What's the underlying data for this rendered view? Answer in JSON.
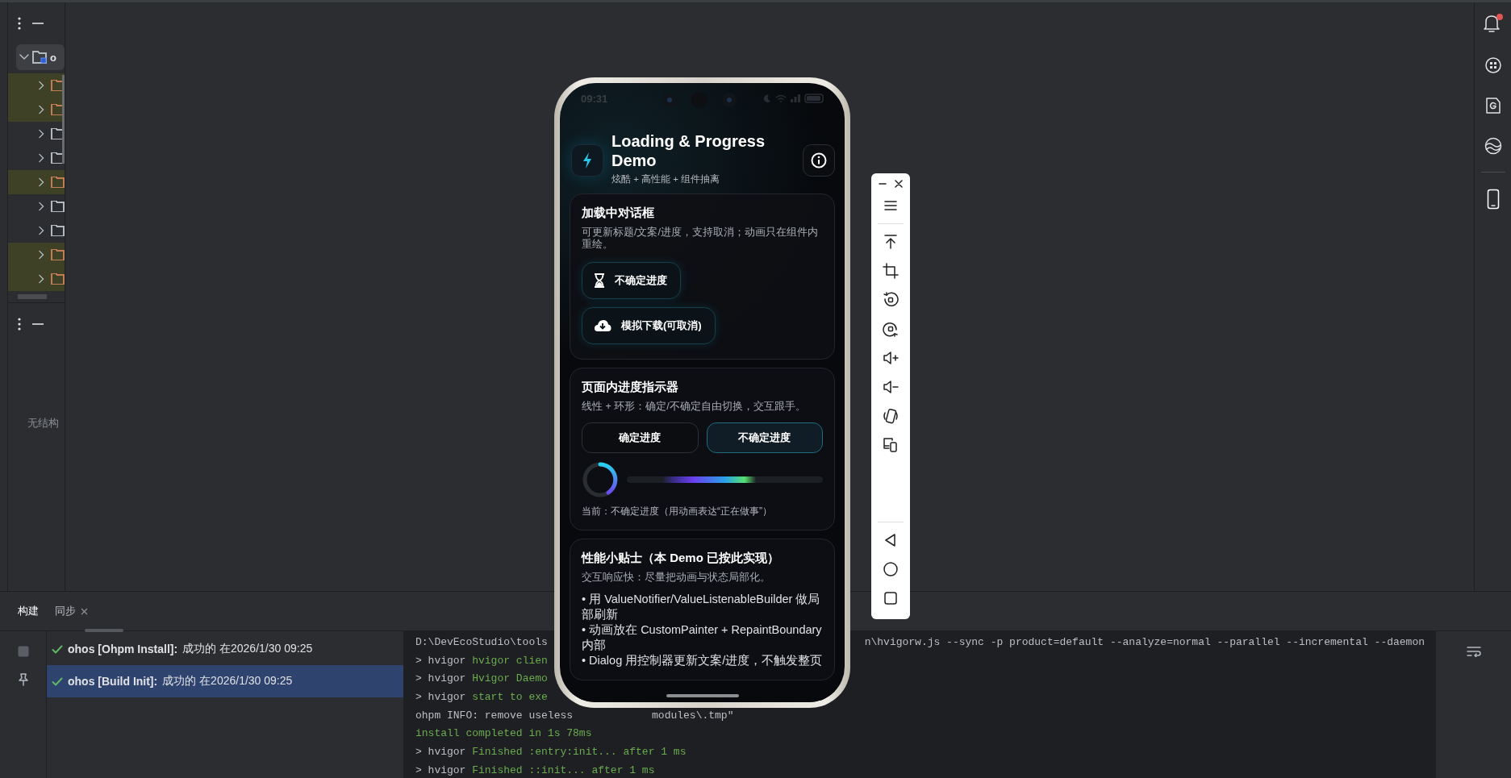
{
  "project_panel": {
    "rows": [
      {
        "label": "o",
        "expanded": true,
        "highlighted": false,
        "color": "#b4b8bf"
      },
      {
        "expanded": false,
        "highlighted": true,
        "color": "#c27d55"
      },
      {
        "expanded": false,
        "highlighted": true,
        "color": "#c27d55"
      },
      {
        "expanded": false,
        "highlighted": false,
        "color": "#b4b8bf"
      },
      {
        "expanded": false,
        "highlighted": false,
        "color": "#b4b8bf"
      },
      {
        "expanded": false,
        "highlighted": true,
        "color": "#c27d55"
      },
      {
        "expanded": false,
        "highlighted": false,
        "color": "#b4b8bf"
      },
      {
        "expanded": false,
        "highlighted": false,
        "color": "#b4b8bf"
      },
      {
        "expanded": false,
        "highlighted": true,
        "color": "#c27d55"
      },
      {
        "expanded": false,
        "highlighted": true,
        "color": "#c27d55"
      }
    ]
  },
  "structure_panel": {
    "empty_text": "无结构"
  },
  "right_sidebar": {
    "notifications_unread": true
  },
  "phone": {
    "status_time": "09:31",
    "header": {
      "title": "Loading & Progress Demo",
      "subtitle": "炫酷 + 高性能 + 组件抽离"
    },
    "cards": [
      {
        "kind": "dialog_demo",
        "title": "加载中对话框",
        "description": "可更新标题/文案/进度，支持取消；动画只在组件内重绘。",
        "actions": [
          {
            "label": "不确定进度"
          },
          {
            "label": "模拟下载(可取消)"
          }
        ]
      },
      {
        "kind": "indicator_demo",
        "title": "页面内进度指示器",
        "description": "线性 + 环形：确定/不确定自由切换，交互跟手。",
        "modes": [
          {
            "label": "确定进度",
            "selected": false
          },
          {
            "label": "不确定进度",
            "selected": true
          }
        ],
        "status": "当前：不确定进度（用动画表达“正在做事”）"
      },
      {
        "kind": "tips",
        "title": "性能小贴士（本 Demo 已按此实现）",
        "description": "交互响应快：尽量把动画与状态局部化。",
        "tips": [
          "• 用 ValueNotifier/ValueListenableBuilder 做局部刷新",
          "• 动画放在 CustomPainter + RepaintBoundary 内部",
          "• Dialog 用控制器更新文案/进度，不触发整页"
        ]
      }
    ]
  },
  "bottom_panel": {
    "tabs": [
      {
        "label": "构建",
        "selected": true,
        "closable": false
      },
      {
        "label": "同步",
        "selected": false,
        "closable": true
      }
    ],
    "build_tree": [
      {
        "succeeded": true,
        "task": "ohos [Ohpm Install]:",
        "detail": "成功的 在2026/1/30 09:25",
        "selected": false
      },
      {
        "succeeded": true,
        "task": "ohos [Build Init]:",
        "detail": "成功的 在2026/1/30 09:25",
        "selected": true
      }
    ],
    "console": [
      {
        "kind": "split_right",
        "parts": [
          {
            "text": "D:\\DevEcoStudio\\tools",
            "color": "#bcbec4"
          }
        ],
        "tail": "n\\hvigorw.js --sync -p product=default --analyze=normal --parallel --incremental --daemon"
      },
      {
        "kind": "plain",
        "parts": [
          {
            "text": "> hvigor ",
            "color": "#bcbec4"
          },
          {
            "text": "hvigor clien",
            "color": "#6aab4f"
          }
        ]
      },
      {
        "kind": "plain",
        "parts": [
          {
            "text": "> hvigor ",
            "color": "#bcbec4"
          },
          {
            "text": "Hvigor Daemo",
            "color": "#6aab4f"
          }
        ]
      },
      {
        "kind": "plain",
        "parts": [
          {
            "text": "> hvigor ",
            "color": "#bcbec4"
          },
          {
            "text": "start to exe",
            "color": "#6aab4f"
          }
        ]
      },
      {
        "kind": "split_low",
        "parts": [
          {
            "text": "ohpm INFO: remove useless",
            "color": "#bcbec4"
          }
        ],
        "tail": "modules\\.tmp\""
      },
      {
        "kind": "plain",
        "parts": [
          {
            "text": "install completed in 1s 78ms",
            "color": "#6aab4f"
          }
        ]
      },
      {
        "kind": "plain",
        "parts": [
          {
            "text": "> hvigor ",
            "color": "#bcbec4"
          },
          {
            "text": "Finished :entry:init... after 1 ms",
            "color": "#6aab4f"
          }
        ]
      },
      {
        "kind": "plain",
        "parts": [
          {
            "text": "> hvigor ",
            "color": "#bcbec4"
          },
          {
            "text": "Finished ::init... after 1 ms",
            "color": "#6aab4f"
          }
        ]
      }
    ]
  }
}
